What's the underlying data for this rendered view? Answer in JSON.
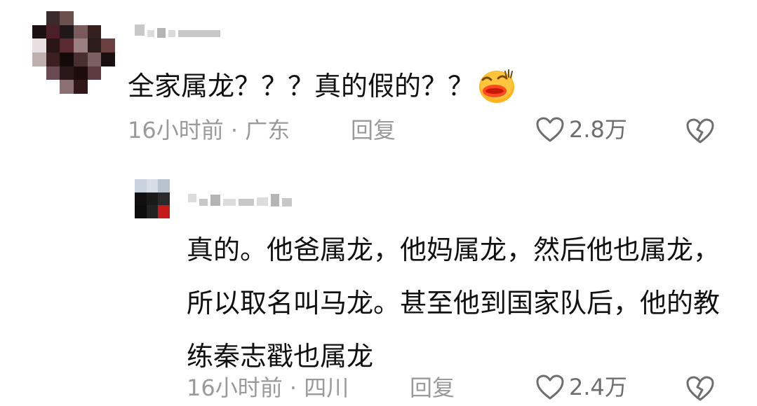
{
  "comment": {
    "text": "全家属龙？？？真的假的？？",
    "emoji": "laughing-tears-emoji",
    "time_location": "16小时前 · 广东",
    "reply_label": "回复",
    "likes": "2.8万"
  },
  "reply": {
    "text": "真的。他爸属龙，他妈属龙，然后他也属龙，所以取名叫马龙。甚至他到国家队后，他的教练秦志戳也属龙",
    "time_location": "16小时前 · 四川",
    "reply_label": "回复",
    "likes": "2.4万"
  },
  "icons": {
    "like": "heart-outline-icon",
    "dislike": "broken-heart-icon"
  },
  "colors": {
    "meta_text": "#9a9a9a",
    "icon_stroke": "#6e6e6e",
    "emoji_face": "#ffb21d",
    "emoji_lips": "#ff4a21"
  }
}
